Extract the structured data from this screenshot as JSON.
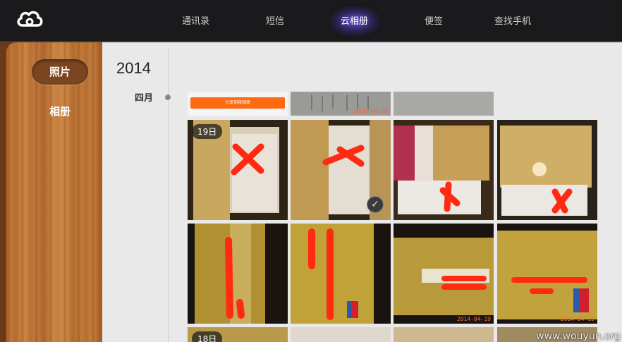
{
  "nav": {
    "items": [
      {
        "label": "通讯录",
        "active": false
      },
      {
        "label": "短信",
        "active": false
      },
      {
        "label": "云相册",
        "active": true
      },
      {
        "label": "便签",
        "active": false
      },
      {
        "label": "查找手机",
        "active": false
      }
    ],
    "accent_color": "#7a5cff"
  },
  "logo": {
    "icon": "cloud-icon"
  },
  "sidebar": {
    "items": [
      {
        "label": "照片",
        "active": true
      },
      {
        "label": "相册",
        "active": false
      }
    ]
  },
  "timeline": {
    "year": "2014",
    "month": "四月",
    "groups": [
      {
        "day": "19日"
      },
      {
        "day": "18日"
      }
    ]
  },
  "photos": {
    "row0": [
      {
        "banner_text": "分享到我相册"
      },
      {
        "date": "2014-04-28"
      },
      {}
    ],
    "row1": [
      {
        "mark": "X"
      },
      {
        "mark": "X",
        "selected_icon": "check-icon"
      },
      {
        "mark": "slash"
      },
      {
        "mark": "X"
      }
    ],
    "row2": [
      {
        "mark": "bars"
      },
      {
        "mark": "bars"
      },
      {
        "mark": "lines",
        "date": "2014-04-19"
      },
      {
        "mark": "lines",
        "date": "2014-04-19"
      }
    ]
  },
  "watermark": "www.wouyun.org"
}
